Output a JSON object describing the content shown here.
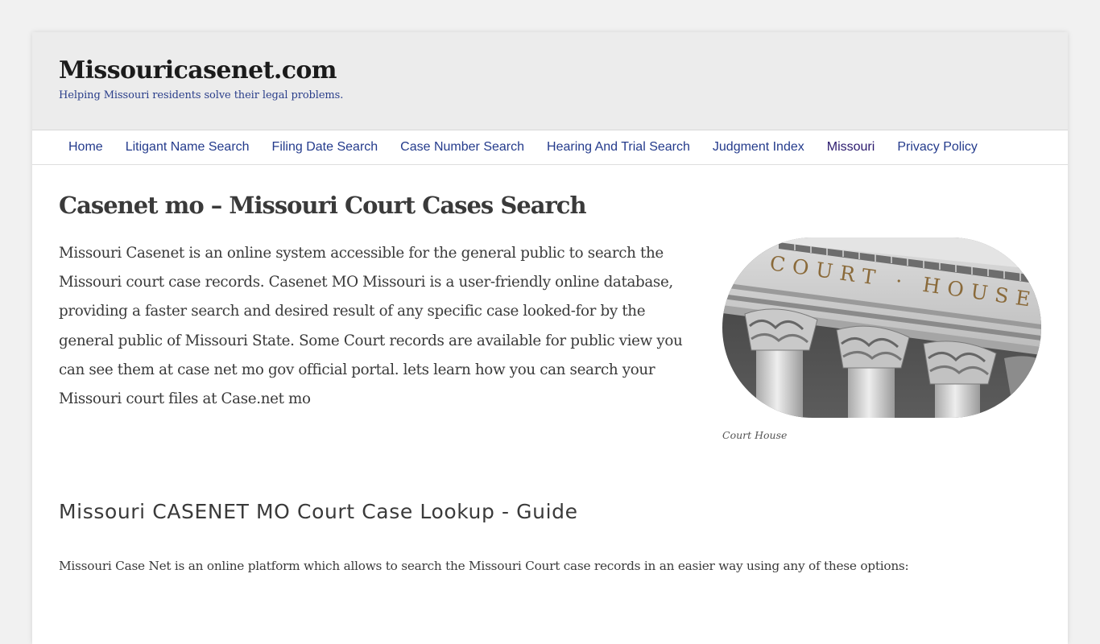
{
  "header": {
    "site_title": "Missouricasenet.com",
    "site_description": "Helping Missouri residents solve their legal problems."
  },
  "nav": {
    "items": [
      {
        "label": "Home"
      },
      {
        "label": "Litigant Name Search"
      },
      {
        "label": "Filing Date Search"
      },
      {
        "label": "Case Number Search"
      },
      {
        "label": "Hearing And Trial Search"
      },
      {
        "label": "Judgment Index"
      },
      {
        "label": "Missouri",
        "visited": true
      },
      {
        "label": "Privacy Policy"
      }
    ],
    "link_color": "#243b8c",
    "visited_color": "#2b1a6e"
  },
  "article": {
    "title": "Casenet mo – Missouri Court Cases Search",
    "intro": "Missouri Casenet is an online system accessible for the general public to search the Missouri court case records. Casenet MO Missouri is a user-friendly online database, providing a faster search and desired result of any specific case looked-for by the general public of Missouri State. Some Court records are available for public view you can see them at case net mo gov official portal. lets learn how you can search your Missouri court files at Case.net mo",
    "figure": {
      "image_alt": "Court House",
      "image_inscription": "COURT · HOUSE ·",
      "caption": "Court House"
    },
    "section_heading": "Missouri CASENET MO Court Case Lookup - Guide",
    "section_text": "Missouri Case Net is an online platform which allows to search the Missouri Court case records in an easier way using any of these options:"
  }
}
